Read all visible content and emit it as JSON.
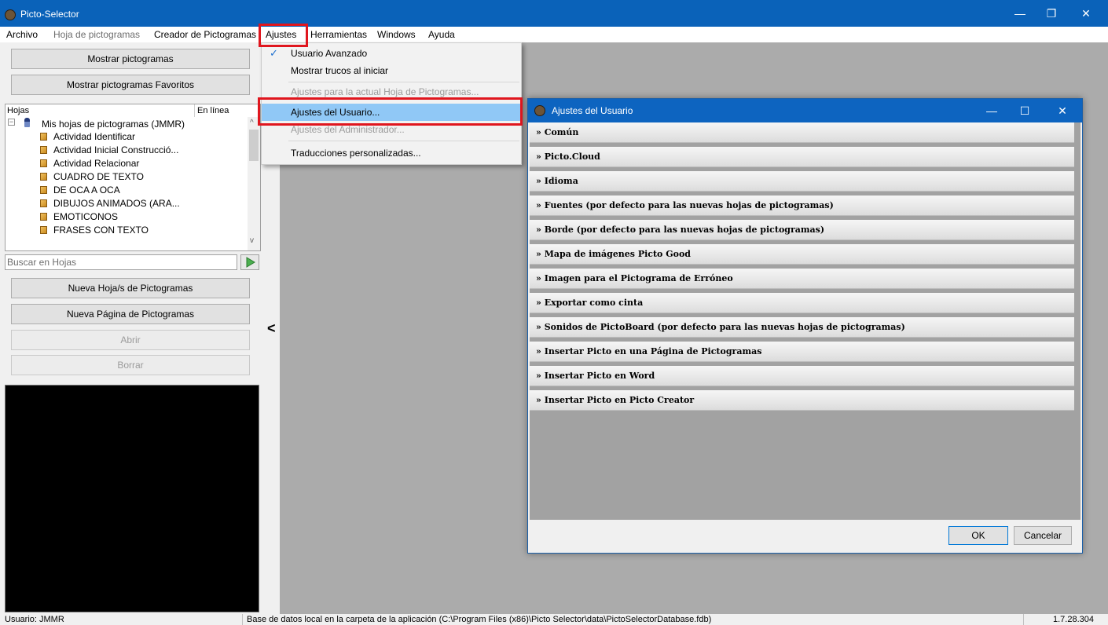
{
  "window": {
    "title": "Picto-Selector",
    "controls": [
      "—",
      "❐",
      "✕"
    ]
  },
  "menubar": {
    "items": [
      "Archivo",
      "Hoja de pictogramas",
      "Creador de Pictogramas",
      "Ajustes",
      "Herramientas",
      "Windows",
      "Ayuda"
    ]
  },
  "leftpanel": {
    "show_pictos": "Mostrar pictogramas",
    "show_favs": "Mostrar pictogramas Favoritos",
    "tree": {
      "col_sheets": "Hojas",
      "col_online": "En línea",
      "root": "Mis hojas de pictogramas (JMMR)",
      "items": [
        "Actividad Identificar",
        "Actividad Inicial Construcció...",
        "Actividad Relacionar",
        "CUADRO DE TEXTO",
        "DE OCA A OCA",
        "DIBUJOS ANIMADOS (ARA...",
        "EMOTICONOS",
        "FRASES CON TEXTO"
      ]
    },
    "search_placeholder": "Buscar en Hojas",
    "new_sheet": "Nueva Hoja/s de Pictogramas",
    "new_page": "Nueva Página de Pictogramas",
    "open": "Abrir",
    "delete": "Borrar"
  },
  "dropdown": {
    "items": [
      "Usuario Avanzado",
      "Mostrar trucos al iniciar",
      "Ajustes para la actual Hoja de Pictogramas...",
      "Ajustes del Usuario...",
      "Ajustes del Administrador...",
      "Traducciones personalizadas..."
    ]
  },
  "dialog": {
    "title": "Ajustes del Usuario",
    "sections": [
      "» Común",
      "» Picto.Cloud",
      "» Idioma",
      "» Fuentes (por defecto para las nuevas hojas de pictogramas)",
      "» Borde (por defecto para las nuevas hojas de pictogramas)",
      "» Mapa de imágenes Picto Good",
      "» Imagen para el Pictograma de Erróneo",
      "» Exportar como cinta",
      "» Sonidos de PictoBoard (por defecto para las nuevas hojas de pictogramas)",
      "» Insertar Picto en una Página de Pictogramas",
      "» Insertar Picto en Word",
      "» Insertar Picto en Picto Creator"
    ],
    "ok": "OK",
    "cancel": "Cancelar",
    "controls": [
      "—",
      "☐",
      "✕"
    ]
  },
  "statusbar": {
    "user": "Usuario: JMMR",
    "db": "Base de datos local en la carpeta de la aplicación (C:\\Program Files (x86)\\Picto Selector\\data\\PictoSelectorDatabase.fdb)",
    "version": "1.7.28.304"
  },
  "colors": {
    "titlebar": "#0a62b9",
    "highlight_box": "#e0161e",
    "menu_selected": "#90c8f6"
  }
}
